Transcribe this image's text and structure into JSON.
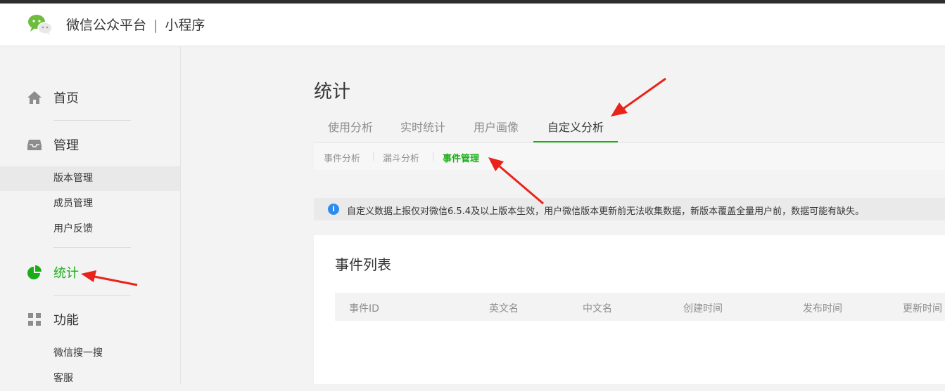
{
  "header": {
    "brand": "微信公众平台",
    "separator": "|",
    "product": "小程序"
  },
  "sidebar": {
    "items": [
      {
        "label": "首页",
        "icon": "home-icon"
      },
      {
        "label": "管理",
        "icon": "inbox-icon"
      },
      {
        "label": "版本管理"
      },
      {
        "label": "成员管理"
      },
      {
        "label": "用户反馈"
      },
      {
        "label": "统计",
        "icon": "pie-chart-icon"
      },
      {
        "label": "功能",
        "icon": "grid-icon"
      },
      {
        "label": "微信搜一搜"
      },
      {
        "label": "客服"
      }
    ],
    "active_color": "#1aad19"
  },
  "main": {
    "title": "统计",
    "tabs": [
      "使用分析",
      "实时统计",
      "用户画像",
      "自定义分析"
    ],
    "subtabs": [
      "事件分析",
      "漏斗分析",
      "事件管理"
    ],
    "notice": "自定义数据上报仅对微信6.5.4及以上版本生效，用户微信版本更新前无法收集数据，新版本覆盖全量用户前，数据可能有缺失。",
    "notice_icon": "info-icon",
    "card": {
      "title": "事件列表",
      "columns": [
        "事件ID",
        "英文名",
        "中文名",
        "创建时间",
        "发布时间",
        "更新时间"
      ]
    }
  },
  "colors": {
    "accent": "#1aad19",
    "annotation_arrow": "#e8231a",
    "info": "#2d8cf0"
  }
}
